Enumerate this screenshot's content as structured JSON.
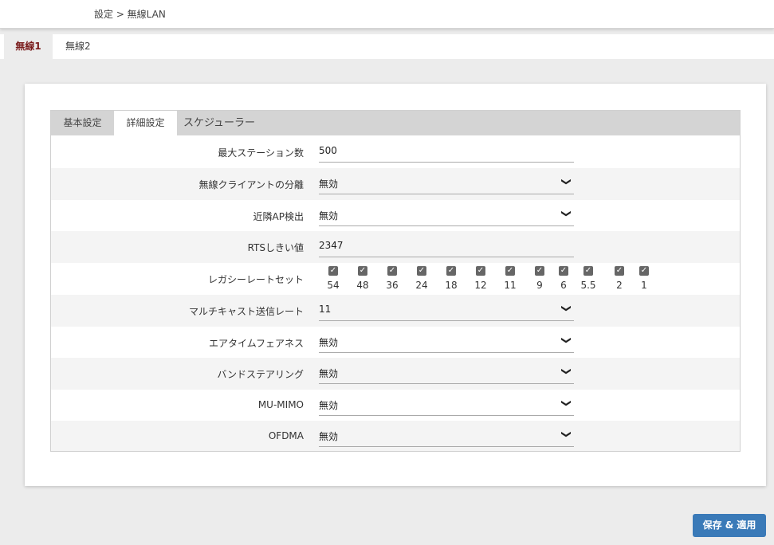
{
  "breadcrumb": "設定 > 無線LAN",
  "top_tabs": [
    "無線1",
    "無線2"
  ],
  "sub_tabs": [
    "基本設定",
    "詳細設定",
    "スケジューラー"
  ],
  "rows": {
    "max_stations": {
      "label": "最大ステーション数",
      "value": "500"
    },
    "client_isolation": {
      "label": "無線クライアントの分離",
      "value": "無効"
    },
    "neighbor_ap": {
      "label": "近隣AP検出",
      "value": "無効"
    },
    "rts": {
      "label": "RTSしきい値",
      "value": "2347"
    },
    "legacy_rates": {
      "label": "レガシーレートセット",
      "rates": [
        "54",
        "48",
        "36",
        "24",
        "18",
        "12",
        "11",
        "9",
        "6",
        "5.5",
        "2",
        "1"
      ]
    },
    "multicast_rate": {
      "label": "マルチキャスト送信レート",
      "value": "11"
    },
    "airtime_fairness": {
      "label": "エアタイムフェアネス",
      "value": "無効"
    },
    "band_steering": {
      "label": "バンドステアリング",
      "value": "無効"
    },
    "mu_mimo": {
      "label": "MU-MIMO",
      "value": "無効"
    },
    "ofdma": {
      "label": "OFDMA",
      "value": "無効"
    }
  },
  "save_label": "保存 & 適用"
}
